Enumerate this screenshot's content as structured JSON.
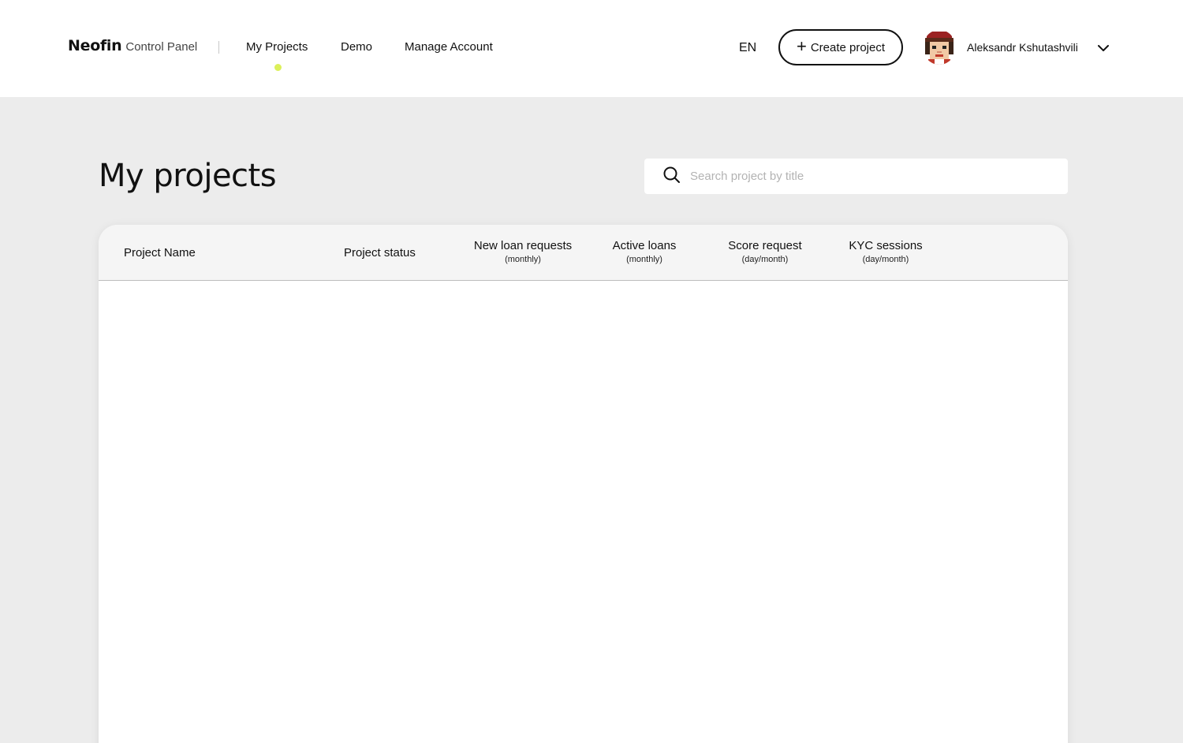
{
  "header": {
    "brand_name": "Neofin",
    "brand_sub": "Control Panel",
    "nav": [
      {
        "label": "My Projects",
        "active": true
      },
      {
        "label": "Demo",
        "active": false
      },
      {
        "label": "Manage Account",
        "active": false
      }
    ],
    "language": "EN",
    "create_button_label": "Create project",
    "user_name": "Aleksandr Kshutashvili",
    "active_indicator_color": "#dcf05a"
  },
  "main": {
    "title": "My projects",
    "search": {
      "placeholder": "Search project by title",
      "value": ""
    },
    "table": {
      "columns": [
        {
          "label": "Project Name",
          "sub": ""
        },
        {
          "label": "Project status",
          "sub": ""
        },
        {
          "label": "New loan requests",
          "sub": "(monthly)"
        },
        {
          "label": "Active loans",
          "sub": "(monthly)"
        },
        {
          "label": "Score request",
          "sub": "(day/month)"
        },
        {
          "label": "KYC sessions",
          "sub": "(day/month)"
        }
      ],
      "rows": []
    }
  },
  "icons": {
    "search": "search-icon",
    "plus": "plus-icon",
    "chevron": "chevron-down-icon",
    "avatar": "pixel-avatar"
  }
}
